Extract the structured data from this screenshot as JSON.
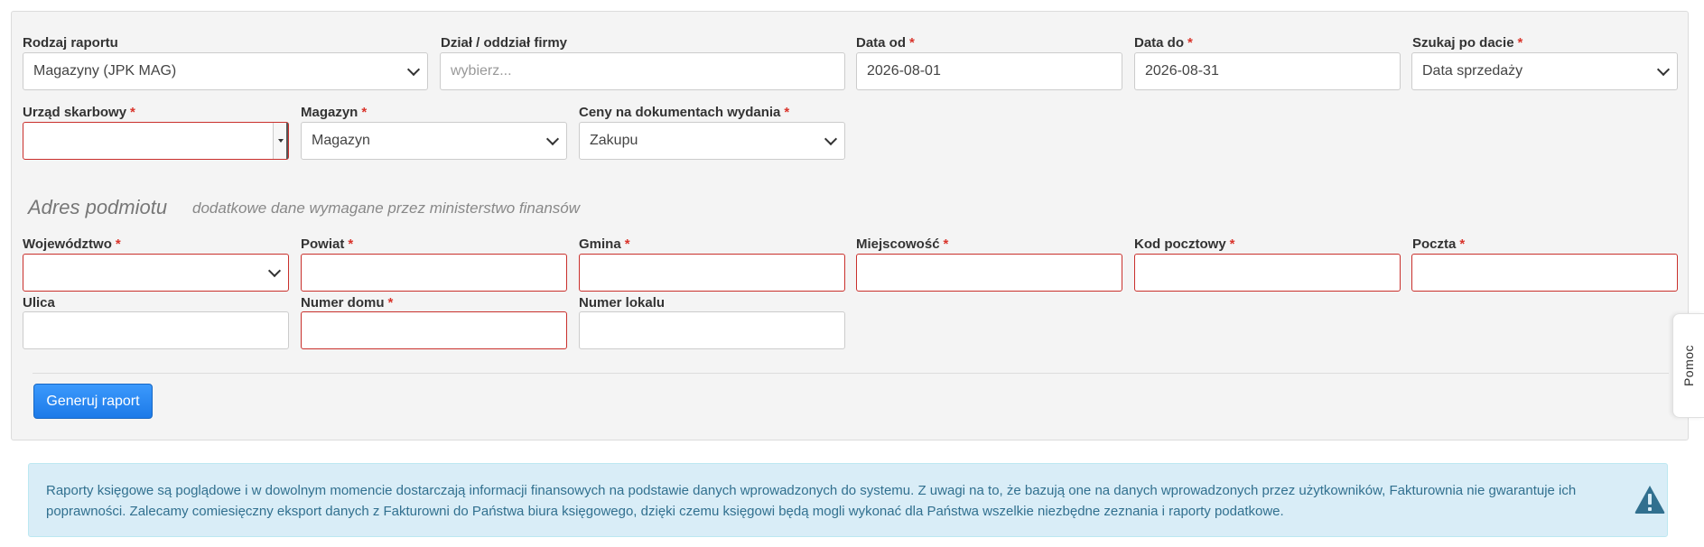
{
  "form": {
    "report_type": {
      "label": "Rodzaj raportu",
      "required": false,
      "value": "Magazyny (JPK MAG)"
    },
    "department": {
      "label": "Dział / oddział firmy",
      "required": false,
      "placeholder": "wybierz..."
    },
    "date_from": {
      "label": "Data od",
      "required": true,
      "value": "2026-08-01"
    },
    "date_to": {
      "label": "Data do",
      "required": true,
      "value": "2026-08-31"
    },
    "search_by_date": {
      "label": "Szukaj po dacie",
      "required": true,
      "value": "Data sprzedaży"
    },
    "tax_office": {
      "label": "Urząd skarbowy",
      "required": true,
      "value": ""
    },
    "warehouse": {
      "label": "Magazyn",
      "required": true,
      "value": "Magazyn"
    },
    "doc_prices": {
      "label": "Ceny na dokumentach wydania",
      "required": true,
      "value": "Zakupu"
    }
  },
  "address_section": {
    "title": "Adres podmiotu",
    "subtitle": "dodatkowe dane wymagane przez ministerstwo finansów",
    "voivodeship": {
      "label": "Województwo",
      "required": true,
      "value": ""
    },
    "county": {
      "label": "Powiat",
      "required": true,
      "value": ""
    },
    "commune": {
      "label": "Gmina",
      "required": true,
      "value": ""
    },
    "city": {
      "label": "Miejscowość",
      "required": true,
      "value": ""
    },
    "postal_code": {
      "label": "Kod pocztowy",
      "required": true,
      "value": ""
    },
    "post_office": {
      "label": "Poczta",
      "required": true,
      "value": ""
    },
    "street": {
      "label": "Ulica",
      "required": false,
      "value": ""
    },
    "house_number": {
      "label": "Numer domu",
      "required": true,
      "value": ""
    },
    "apartment_number": {
      "label": "Numer lokalu",
      "required": false,
      "value": ""
    }
  },
  "required_marker": "*",
  "generate_button": "Generuj raport",
  "help_tab": "Pomoc",
  "info_text": "Raporty księgowe są poglądowe i w dowolnym momencie dostarczają informacji finansowych na podstawie danych wprowadzonych do systemu. Z uwagi na to, że bazują one na danych wprowadzonych przez użytkowników, Fakturownia nie gwarantuje ich poprawności. Zalecamy comiesięczny eksport danych z Fakturowni do Państwa biura księgowego, dzięki czemu księgowi będą mogli wykonać dla Państwa wszelkie niezbędne zeznania i raporty podatkowe.",
  "icons": {
    "warning": "warning-triangle-icon",
    "chevron": "chevron-down-icon"
  },
  "colors": {
    "primary": "#1d7ae8",
    "error_border": "#c9302c",
    "required": "#d9342b",
    "info_bg": "#d9edf7",
    "info_text": "#31708f"
  }
}
